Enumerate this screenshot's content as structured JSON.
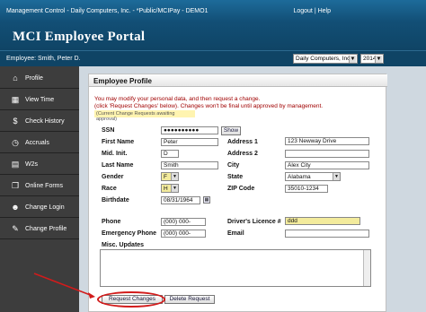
{
  "topbar": {
    "breadcrumb": "Management Control - Daily Computers, Inc. - *Public/MCIPay - DEMO1",
    "logout": "Logout",
    "separator": "|",
    "help": "Help"
  },
  "header": {
    "title": "MCI Employee Portal"
  },
  "subbar": {
    "employee": "Employee: Smith, Peter D.",
    "company_select": "Daily Computers, Inc.",
    "year_select": "2014"
  },
  "sidebar": {
    "items": [
      {
        "label": "Profile",
        "icon": "house-icon"
      },
      {
        "label": "View Time",
        "icon": "calendar-icon"
      },
      {
        "label": "Check History",
        "icon": "money-bag-icon"
      },
      {
        "label": "Accruals",
        "icon": "clock-icon"
      },
      {
        "label": "W2s",
        "icon": "document-icon"
      },
      {
        "label": "Online Forms",
        "icon": "forms-icon"
      },
      {
        "label": "Change Login",
        "icon": "user-icon"
      },
      {
        "label": "Change Profile",
        "icon": "user-edit-icon"
      }
    ]
  },
  "panel": {
    "title": "Employee Profile",
    "note1": "You may modify your personal data, and then request a change.",
    "note2": "(click 'Request Changes' below). Changes won't be final until approved by management.",
    "pending": "(Current Change Requests awaiting approval)"
  },
  "form": {
    "ssn_label": "SSN",
    "ssn_value": "●●●●●●●●●●",
    "show_button": "Show",
    "first_name_label": "First Name",
    "first_name_value": "Peter",
    "mid_init_label": "Mid. Init.",
    "mid_init_value": "D",
    "last_name_label": "Last Name",
    "last_name_value": "Smith",
    "gender_label": "Gender",
    "gender_value": "F",
    "race_label": "Race",
    "race_value": "H",
    "birthdate_label": "Birthdate",
    "birthdate_value": "08/31/1964",
    "address1_label": "Address 1",
    "address1_value": "123 Newway Drive",
    "address2_label": "Address 2",
    "address2_value": "",
    "city_label": "City",
    "city_value": "Alex City",
    "state_label": "State",
    "state_value": "Alabama",
    "zip_label": "ZIP Code",
    "zip_value": "35010-1234",
    "phone_label": "Phone",
    "phone_value": "(000) 000-0000",
    "emergency_label": "Emergency Phone",
    "emergency_value": "(000) 000-0000",
    "license_label": "Driver's Licence #",
    "license_value": "ddd",
    "email_label": "Email",
    "email_value": "",
    "misc_label": "Misc. Updates"
  },
  "buttons": {
    "request": "Request Changes",
    "delete": "Delete Request"
  },
  "colors": {
    "header_blue": "#124f76",
    "sidebar": "#3d3d3d",
    "note_red": "#a00000",
    "highlight_ring": "#d21b1b"
  }
}
